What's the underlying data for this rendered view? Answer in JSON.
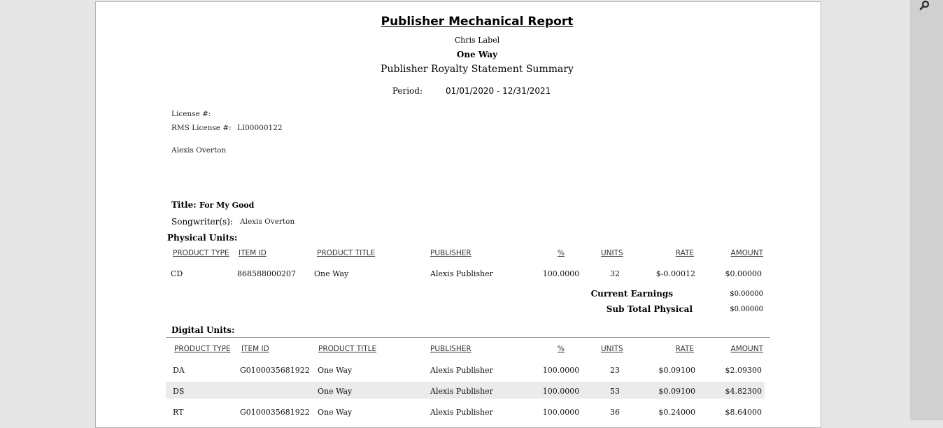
{
  "report": {
    "title": "Publisher Mechanical Report",
    "label_name": "Chris Label",
    "album": "One Way",
    "subtitle": "Publisher Royalty Statement Summary",
    "period_label": "Period:",
    "period_value": "01/01/2020 - 12/31/2021"
  },
  "license": {
    "license_label": "License #:",
    "license_value": "",
    "rms_label": "RMS License #:",
    "rms_value": "LI00000122",
    "payee": "Alexis Overton"
  },
  "song": {
    "title_label": "Title:",
    "title_value": "For My Good",
    "songwriter_label": "Songwriter(s):",
    "songwriter_value": "Alexis Overton"
  },
  "columns": [
    "PRODUCT TYPE",
    "ITEM ID",
    "PRODUCT TITLE",
    "PUBLISHER",
    "%",
    "UNITS",
    "RATE",
    "AMOUNT"
  ],
  "physical": {
    "heading": "Physical Units:",
    "rows": [
      [
        "CD",
        "868588000207",
        "One Way",
        "Alexis Publisher",
        "100.0000",
        "32",
        "$-0.00012",
        "$0.00000"
      ]
    ],
    "current_earnings_label": "Current Earnings",
    "current_earnings_value": "$0.00000",
    "subtotal_label": "Sub Total Physical",
    "subtotal_value": "$0.00000"
  },
  "digital": {
    "heading": "Digital Units:",
    "rows": [
      [
        "DA",
        "G0100035681922",
        "One Way",
        "Alexis Publisher",
        "100.0000",
        "23",
        "$0.09100",
        "$2.09300"
      ],
      [
        "DS",
        "",
        "One Way",
        "Alexis Publisher",
        "100.0000",
        "53",
        "$0.09100",
        "$4.82300"
      ],
      [
        "RT",
        "G0100035681922",
        "One Way",
        "Alexis Publisher",
        "100.0000",
        "36",
        "$0.24000",
        "$8.64000"
      ]
    ]
  },
  "colors": {
    "viewer_bg": "#e6e6e6",
    "scrollbar": "#d0d0d0",
    "row_stripe": "#ebebeb",
    "divider": "#9a9a9a"
  },
  "icons": {
    "search": "magnifier-icon"
  }
}
